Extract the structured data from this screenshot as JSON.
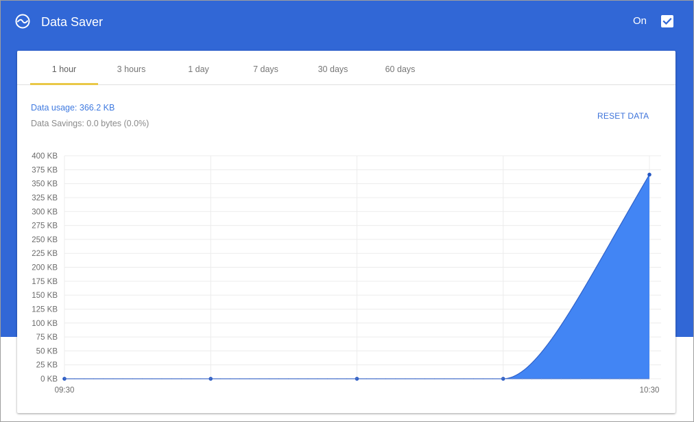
{
  "header": {
    "logo_icon": "data-saver-icon",
    "title": "Data Saver",
    "toggle_label": "On",
    "toggle_checked": true,
    "brand_color": "#3167d6"
  },
  "tabs": [
    {
      "label": "1 hour",
      "active": true
    },
    {
      "label": "3 hours",
      "active": false
    },
    {
      "label": "1 day",
      "active": false
    },
    {
      "label": "7 days",
      "active": false
    },
    {
      "label": "30 days",
      "active": false
    },
    {
      "label": "60 days",
      "active": false
    }
  ],
  "summary": {
    "usage": "Data usage: 366.2 KB",
    "savings": "Data Savings: 0.0 bytes (0.0%)",
    "reset_label": "RESET DATA"
  },
  "chart_data": {
    "type": "area",
    "x_labels": [
      "09:30",
      "10:30"
    ],
    "x": [
      "09:30",
      "09:45",
      "10:00",
      "10:15",
      "10:30"
    ],
    "y_unit": "KB",
    "ylim": [
      0,
      400
    ],
    "y_ticks": [
      "0 KB",
      "25 KB",
      "50 KB",
      "75 KB",
      "100 KB",
      "125 KB",
      "150 KB",
      "175 KB",
      "200 KB",
      "225 KB",
      "250 KB",
      "275 KB",
      "300 KB",
      "325 KB",
      "350 KB",
      "375 KB",
      "400 KB"
    ],
    "series": [
      {
        "values": [
          0,
          0,
          0,
          0,
          366.2
        ],
        "color": "#4285f4"
      }
    ],
    "grid": true
  }
}
